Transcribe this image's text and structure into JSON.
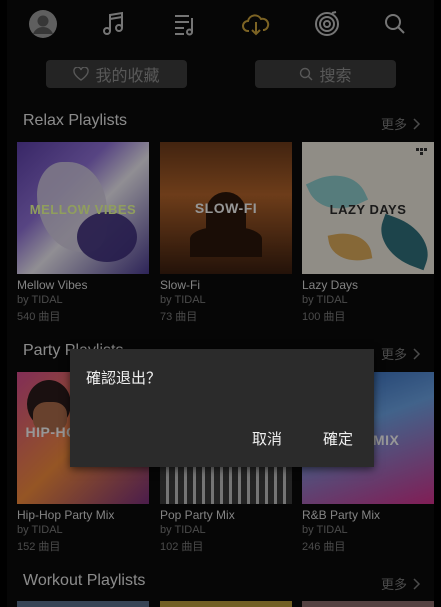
{
  "nav": {
    "icons": [
      "avatar-icon",
      "music-note-icon",
      "playlist-icon",
      "cloud-download-icon",
      "radio-icon",
      "search-icon"
    ],
    "active_color": "#c9a13b"
  },
  "buttons": {
    "favorites_label": "我的收藏",
    "search_label": "搜索"
  },
  "sections": [
    {
      "title": "Relax Playlists",
      "more": "更多",
      "cards": [
        {
          "cover_text": "MELLOW VIBES",
          "title": "Mellow Vibes",
          "by": "by TIDAL",
          "count": "540 曲目"
        },
        {
          "cover_text": "SLOW-FI",
          "title": "Slow-Fi",
          "by": "by TIDAL",
          "count": "73 曲目"
        },
        {
          "cover_text": "LAZY DAYS",
          "title": "Lazy Days",
          "by": "by TIDAL",
          "count": "100 曲目"
        }
      ]
    },
    {
      "title": "Party Playlists",
      "more": "更多",
      "cards": [
        {
          "cover_text": "HIP-HOP PARTY",
          "title": "Hip-Hop Party Mix",
          "by": "by TIDAL",
          "count": "152 曲目"
        },
        {
          "cover_text": "",
          "title": "Pop Party Mix",
          "by": "by TIDAL",
          "count": "102 曲目"
        },
        {
          "cover_text": "R&B MIX",
          "title": "R&B Party Mix",
          "by": "by TIDAL",
          "count": "246 曲目"
        }
      ]
    },
    {
      "title": "Workout Playlists",
      "more": "更多"
    }
  ],
  "dialog": {
    "message": "確認退出？",
    "cancel": "取消",
    "confirm": "確定"
  }
}
